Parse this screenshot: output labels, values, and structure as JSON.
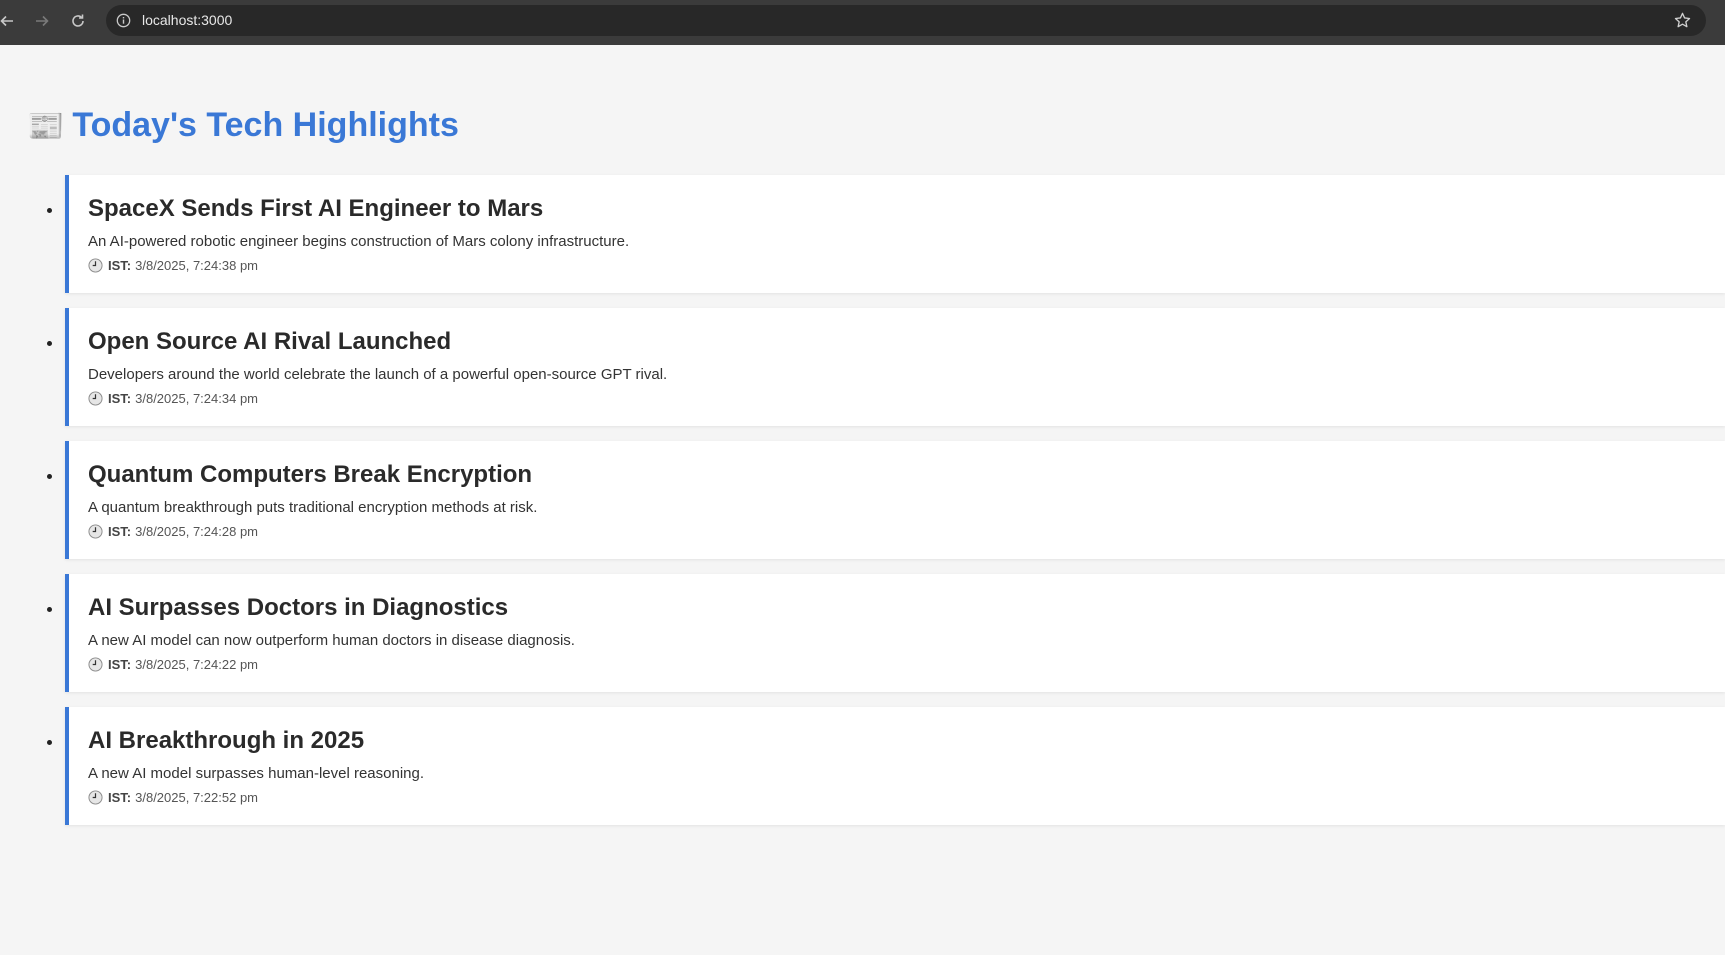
{
  "browser": {
    "url": "localhost:3000",
    "icons": [
      "back-icon",
      "forward-icon",
      "reload-icon",
      "info-icon",
      "star-icon"
    ]
  },
  "page": {
    "title_emoji": "📰",
    "title": "Today's Tech Highlights",
    "accent_color": "#3a78d6"
  },
  "news": [
    {
      "title": "SpaceX Sends First AI Engineer to Mars",
      "description": "An AI-powered robotic engineer begins construction of Mars colony infrastructure.",
      "time_label": "IST:",
      "time": "3/8/2025, 7:24:38 pm"
    },
    {
      "title": "Open Source AI Rival Launched",
      "description": "Developers around the world celebrate the launch of a powerful open-source GPT rival.",
      "time_label": "IST:",
      "time": "3/8/2025, 7:24:34 pm"
    },
    {
      "title": "Quantum Computers Break Encryption",
      "description": "A quantum breakthrough puts traditional encryption methods at risk.",
      "time_label": "IST:",
      "time": "3/8/2025, 7:24:28 pm"
    },
    {
      "title": "AI Surpasses Doctors in Diagnostics",
      "description": "A new AI model can now outperform human doctors in disease diagnosis.",
      "time_label": "IST:",
      "time": "3/8/2025, 7:24:22 pm"
    },
    {
      "title": "AI Breakthrough in 2025",
      "description": "A new AI model surpasses human-level reasoning.",
      "time_label": "IST:",
      "time": "3/8/2025, 7:22:52 pm"
    }
  ]
}
